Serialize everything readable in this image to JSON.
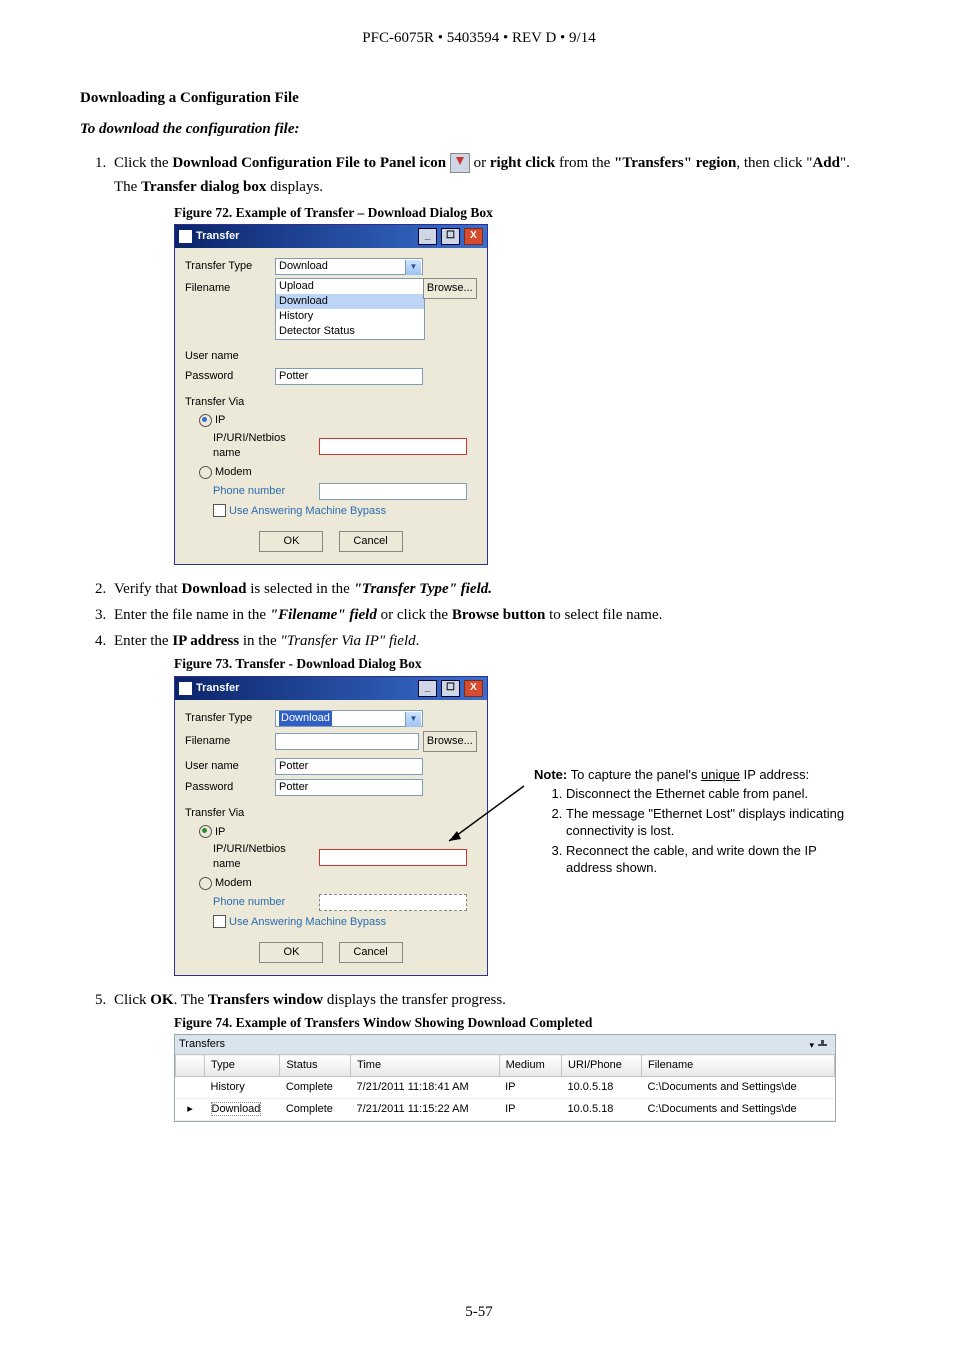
{
  "header": "PFC-6075R • 5403594 • REV D • 9/14",
  "section_title": "Downloading a Configuration File",
  "section_lead": "To download the configuration file:",
  "step1_a": "Click the ",
  "step1_b": "Download Configuration File to Panel icon",
  "step1_c": " or ",
  "step1_d": "right click",
  "step1_e": " from the ",
  "step1_f": "\"Transfers\" region",
  "step1_g": ", then click \"",
  "step1_h": "Add",
  "step1_i": "\".",
  "step1_line2_a": "The ",
  "step1_line2_b": "Transfer dialog box",
  "step1_line2_c": " displays.",
  "fig72": "Figure 72.  Example of Transfer – Download Dialog Box",
  "dlg": {
    "title": "Transfer",
    "lbl_type": "Transfer Type",
    "lbl_file": "Filename",
    "lbl_user": "User name",
    "lbl_pass": "Password",
    "lbl_via": "Transfer Via",
    "lbl_ip": "IP",
    "lbl_ipfield": "IP/URI/Netbios name",
    "lbl_modem": "Modem",
    "lbl_phone": "Phone number",
    "lbl_amb": "Use Answering Machine Bypass",
    "btn_browse": "Browse...",
    "btn_ok": "OK",
    "btn_cancel": "Cancel",
    "type_sel": "Download",
    "type_opts": [
      "Upload",
      "Download",
      "History",
      "Detector Status"
    ],
    "val_user": "Potter",
    "val_user2": "Potter",
    "val_pass2": "Potter"
  },
  "step2_a": "Verify that ",
  "step2_b": "Download",
  "step2_c": " is selected in the ",
  "step2_d": "\"Transfer Type\" field.",
  "step3_a": "Enter the file name in the ",
  "step3_b": "\"Filename\" field",
  "step3_c": " or click the ",
  "step3_d": "Browse button",
  "step3_e": " to select file name.",
  "step4_a": "Enter the ",
  "step4_b": "IP address",
  "step4_c": " in the ",
  "step4_d": "\"Transfer Via IP\" field",
  "step4_e": ".",
  "fig73": "Figure 73.  Transfer - Download Dialog Box",
  "note_lead_a": "Note:",
  "note_lead_b": " To capture the panel's ",
  "note_lead_c": "unique",
  "note_lead_d": " IP address:",
  "note_items": [
    "Disconnect the Ethernet cable from panel.",
    "The message \"Ethernet Lost\" displays indicating connectivity is lost.",
    "Reconnect the cable, and write down the IP address shown."
  ],
  "step5_a": "Click ",
  "step5_b": "OK",
  "step5_c": ". The ",
  "step5_d": "Transfers window",
  "step5_e": " displays the transfer progress.",
  "fig74": "Figure 74. Example of Transfers Window Showing Download Completed",
  "twin": {
    "title": "Transfers",
    "cols": [
      "Type",
      "Status",
      "Time",
      "Medium",
      "URI/Phone",
      "Filename"
    ],
    "rows": [
      [
        "History",
        "Complete",
        "7/21/2011 11:18:41 AM",
        "IP",
        "10.0.5.18",
        "C:\\Documents and Settings\\de"
      ],
      [
        "Download",
        "Complete",
        "7/21/2011 11:15:22 AM",
        "IP",
        "10.0.5.18",
        "C:\\Documents and Settings\\de"
      ]
    ]
  },
  "page_num": "5-57"
}
